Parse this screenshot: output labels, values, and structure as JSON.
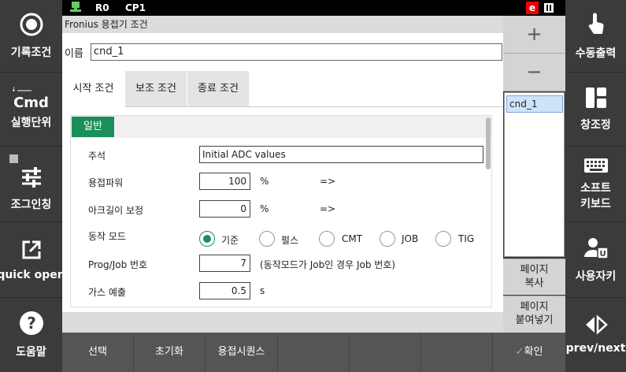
{
  "status_bar": {
    "robot": "R0",
    "cp": "CP1",
    "e_badge": "e"
  },
  "left_sidebar": {
    "items": [
      {
        "label": "기록조건",
        "icon": "record-icon"
      },
      {
        "label": "실행단위",
        "icon": "cmd-icon",
        "icon_text": "Cmd"
      },
      {
        "label": "조그인칭",
        "icon": "sliders-icon"
      },
      {
        "label": "quick open",
        "icon": "external-link-icon"
      },
      {
        "label": "도움말",
        "icon": "help-icon"
      }
    ]
  },
  "right_sidebar": {
    "items": [
      {
        "label": "수동출력",
        "icon": "touch-hand-icon"
      },
      {
        "label": "창조정",
        "icon": "window-layout-icon"
      },
      {
        "label_line1": "소프트",
        "label_line2": "키보드",
        "icon": "keyboard-icon"
      },
      {
        "label": "사용자키",
        "icon": "user-key-icon"
      },
      {
        "label": "prev/next",
        "icon": "prev-next-icon"
      }
    ]
  },
  "window": {
    "title": "Fronius 용접기 조건"
  },
  "name_field": {
    "label": "이름",
    "value": "cnd_1"
  },
  "tabs": [
    {
      "label": "시작 조건",
      "active": true
    },
    {
      "label": "보조 조건",
      "active": false
    },
    {
      "label": "종료 조건",
      "active": false
    }
  ],
  "section": {
    "label": "일반"
  },
  "form": {
    "comment": {
      "label": "주석",
      "value": "Initial ADC values"
    },
    "weld_power": {
      "label": "용접파워",
      "value": "100",
      "unit": "%",
      "arrow": "=>"
    },
    "arc_length": {
      "label": "아크길이 보정",
      "value": "0",
      "unit": "%",
      "arrow": "=>"
    },
    "mode": {
      "label": "동작 모드",
      "options": [
        "기준",
        "펄스",
        "CMT",
        "JOB",
        "TIG"
      ],
      "selected": "기준"
    },
    "prog_job": {
      "label": "Prog/Job 번호",
      "value": "7",
      "note": "(동작모드가 Job인 경우 Job 번호)"
    },
    "gas_pre": {
      "label": "가스 예출",
      "value": "0.5",
      "unit": "s"
    }
  },
  "pages_panel": {
    "add": "+",
    "remove": "−",
    "items": [
      "cnd_1"
    ],
    "copy_line1": "페이지",
    "copy_line2": "복사",
    "paste_line1": "페이지",
    "paste_line2": "붙여넣기"
  },
  "bottom_menu": {
    "select": "선택",
    "reset": "초기화",
    "weld_sequence": "용접시퀀스",
    "confirm": "확인"
  },
  "colors": {
    "accent_green": "#1a8f5a",
    "sidebar_dark": "#3b3b3b",
    "badge_red": "#e00000"
  }
}
